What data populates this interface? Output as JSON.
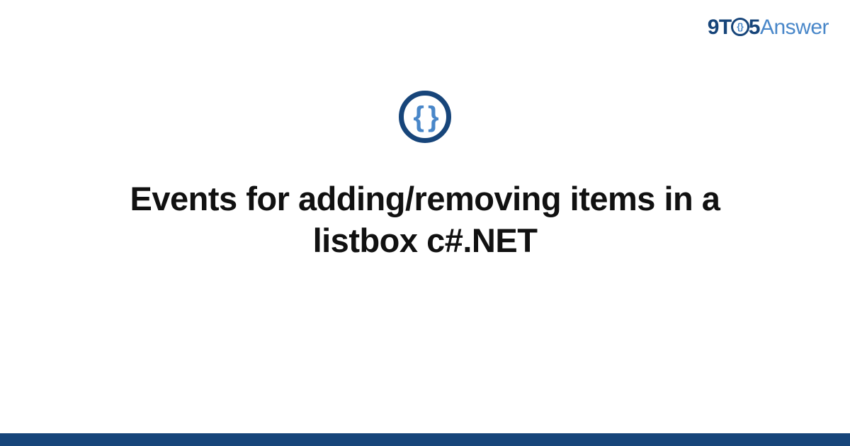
{
  "logo": {
    "part1": "9T",
    "inner": "{}",
    "part2": "5",
    "part3": "Answer"
  },
  "icon": {
    "braces": "{ }"
  },
  "title": "Events for adding/removing items in a listbox c#.NET",
  "colors": {
    "dark": "#17457a",
    "light": "#4987c9",
    "text": "#111111"
  }
}
